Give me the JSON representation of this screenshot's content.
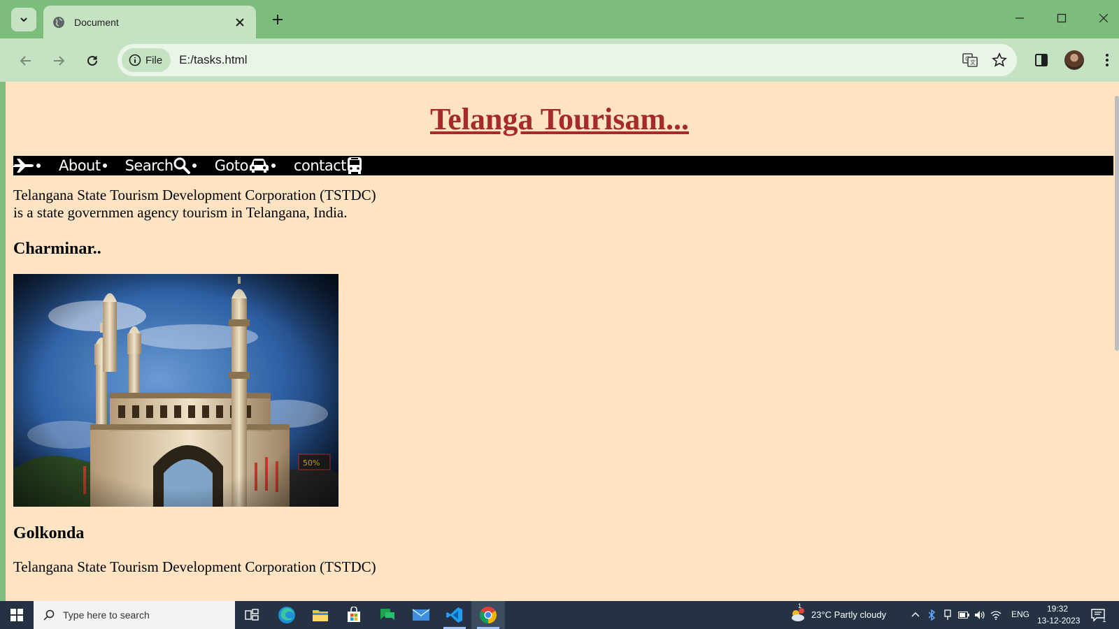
{
  "browser": {
    "tab_title": "Document",
    "chip_label": "File",
    "url": "E:/tasks.html"
  },
  "page": {
    "title": "Telanga Tourisam...",
    "nav": [
      {
        "label": ""
      },
      {
        "label": "About"
      },
      {
        "label": "Search"
      },
      {
        "label": "Goto"
      },
      {
        "label": "contact"
      }
    ],
    "intro_line1": "Telangana State Tourism Development Corporation (TSTDC)",
    "intro_line2": "is a state governmen agency tourism in Telangana, India.",
    "section1_heading": "Charminar..",
    "section2_heading": "Golkonda",
    "section2_text": "Telangana State Tourism Development Corporation (TSTDC)"
  },
  "taskbar": {
    "search_placeholder": "Type here to search",
    "weather": "23°C  Partly cloudy",
    "weather_badge": "1",
    "language": "ENG",
    "time": "19:32",
    "date": "13-12-2023",
    "notification_count": "1"
  },
  "icons": {
    "nav": [
      "plane-icon",
      "search-icon",
      "car-icon",
      "bus-icon"
    ],
    "tabbar": [
      "tab-list-icon",
      "globe-icon",
      "close-icon",
      "plus-icon"
    ],
    "window": [
      "minimize-icon",
      "maximize-icon",
      "window-close-icon"
    ],
    "toolbar": [
      "back-icon",
      "forward-icon",
      "reload-icon",
      "info-icon",
      "translate-icon",
      "star-icon",
      "side-panel-icon",
      "profile-avatar",
      "menu-icon"
    ]
  },
  "colors": {
    "page_background": "#ffe4c4",
    "title_color": "#a52a2a",
    "navbar_background": "#000000",
    "browser_frame": "#7dbd7b",
    "browser_toolbar": "#c5e3c2",
    "taskbar": "#243244"
  }
}
